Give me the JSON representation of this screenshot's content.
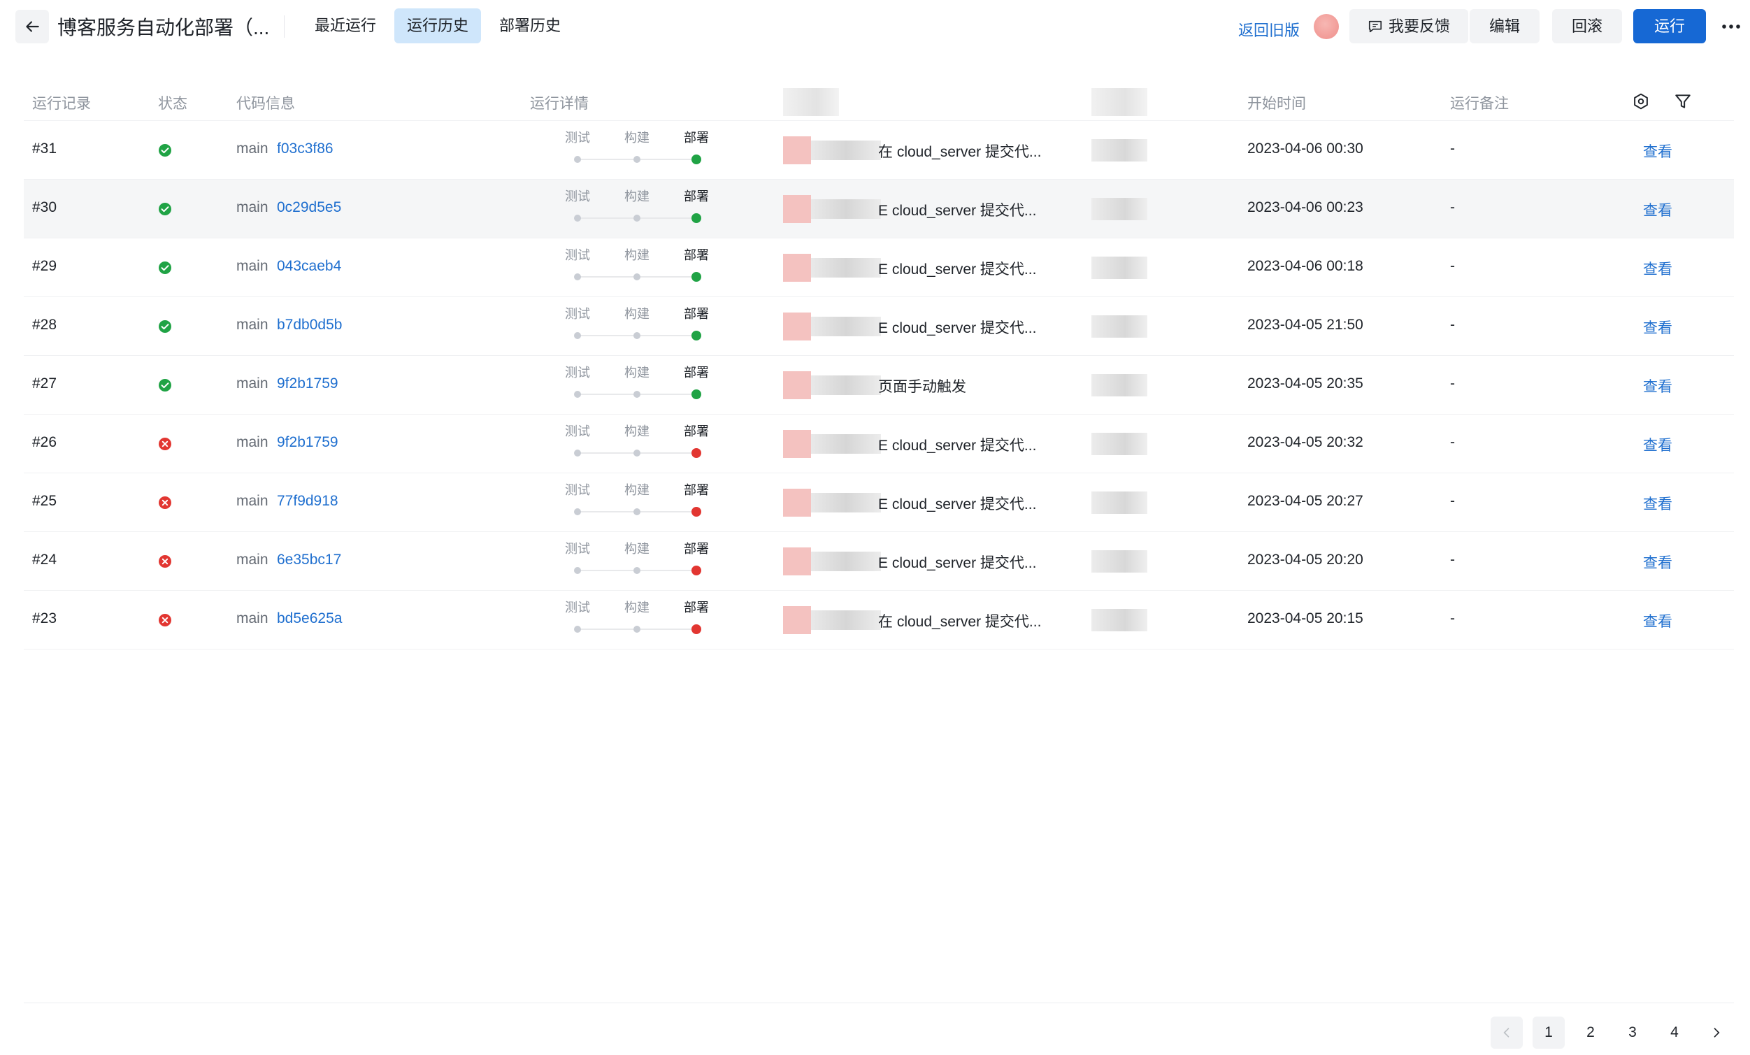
{
  "header": {
    "title": "博客服务自动化部署（...",
    "tabs": [
      {
        "label": "最近运行",
        "active": false
      },
      {
        "label": "运行历史",
        "active": true
      },
      {
        "label": "部署历史",
        "active": false
      }
    ],
    "old_version_link": "返回旧版",
    "feedback_label": "我要反馈",
    "edit_label": "编辑",
    "rollback_label": "回滚",
    "run_label": "运行"
  },
  "table": {
    "columns": [
      "运行记录",
      "状态",
      "代码信息",
      "运行详情",
      "开始时间",
      "运行备注"
    ],
    "stage_names": [
      "测试",
      "构建",
      "部署"
    ],
    "rows": [
      {
        "id": "#31",
        "status": "success",
        "branch": "main",
        "commit": "f03c3f86",
        "trigger": "在 cloud_server 提交代...",
        "start_time": "2023-04-06 00:30",
        "note": "-",
        "action": "查看"
      },
      {
        "id": "#30",
        "status": "success",
        "branch": "main",
        "commit": "0c29d5e5",
        "trigger": "E cloud_server 提交代...",
        "start_time": "2023-04-06 00:23",
        "note": "-",
        "action": "查看"
      },
      {
        "id": "#29",
        "status": "success",
        "branch": "main",
        "commit": "043caeb4",
        "trigger": "E cloud_server 提交代...",
        "start_time": "2023-04-06 00:18",
        "note": "-",
        "action": "查看"
      },
      {
        "id": "#28",
        "status": "success",
        "branch": "main",
        "commit": "b7db0d5b",
        "trigger": "E cloud_server 提交代...",
        "start_time": "2023-04-05 21:50",
        "note": "-",
        "action": "查看"
      },
      {
        "id": "#27",
        "status": "success",
        "branch": "main",
        "commit": "9f2b1759",
        "trigger": "页面手动触发",
        "start_time": "2023-04-05 20:35",
        "note": "-",
        "action": "查看"
      },
      {
        "id": "#26",
        "status": "failed",
        "branch": "main",
        "commit": "9f2b1759",
        "trigger": "E cloud_server 提交代...",
        "start_time": "2023-04-05 20:32",
        "note": "-",
        "action": "查看"
      },
      {
        "id": "#25",
        "status": "failed",
        "branch": "main",
        "commit": "77f9d918",
        "trigger": "E cloud_server 提交代...",
        "start_time": "2023-04-05 20:27",
        "note": "-",
        "action": "查看"
      },
      {
        "id": "#24",
        "status": "failed",
        "branch": "main",
        "commit": "6e35bc17",
        "trigger": "E cloud_server 提交代...",
        "start_time": "2023-04-05 20:20",
        "note": "-",
        "action": "查看"
      },
      {
        "id": "#23",
        "status": "failed",
        "branch": "main",
        "commit": "bd5e625a",
        "trigger": "在 cloud_server 提交代...",
        "start_time": "2023-04-05 20:15",
        "note": "-",
        "action": "查看"
      }
    ]
  },
  "pagination": {
    "pages": [
      "1",
      "2",
      "3",
      "4"
    ],
    "current": "1"
  },
  "colors": {
    "success": "#20a345",
    "failed": "#e23631",
    "link": "#1f6fcf",
    "primary": "#1668d4"
  },
  "icons": [
    "back-arrow-icon",
    "feedback-icon",
    "more-icon",
    "settings-icon",
    "filter-icon",
    "chevron-left-icon",
    "chevron-right-icon",
    "success-check-icon",
    "failure-x-icon"
  ]
}
